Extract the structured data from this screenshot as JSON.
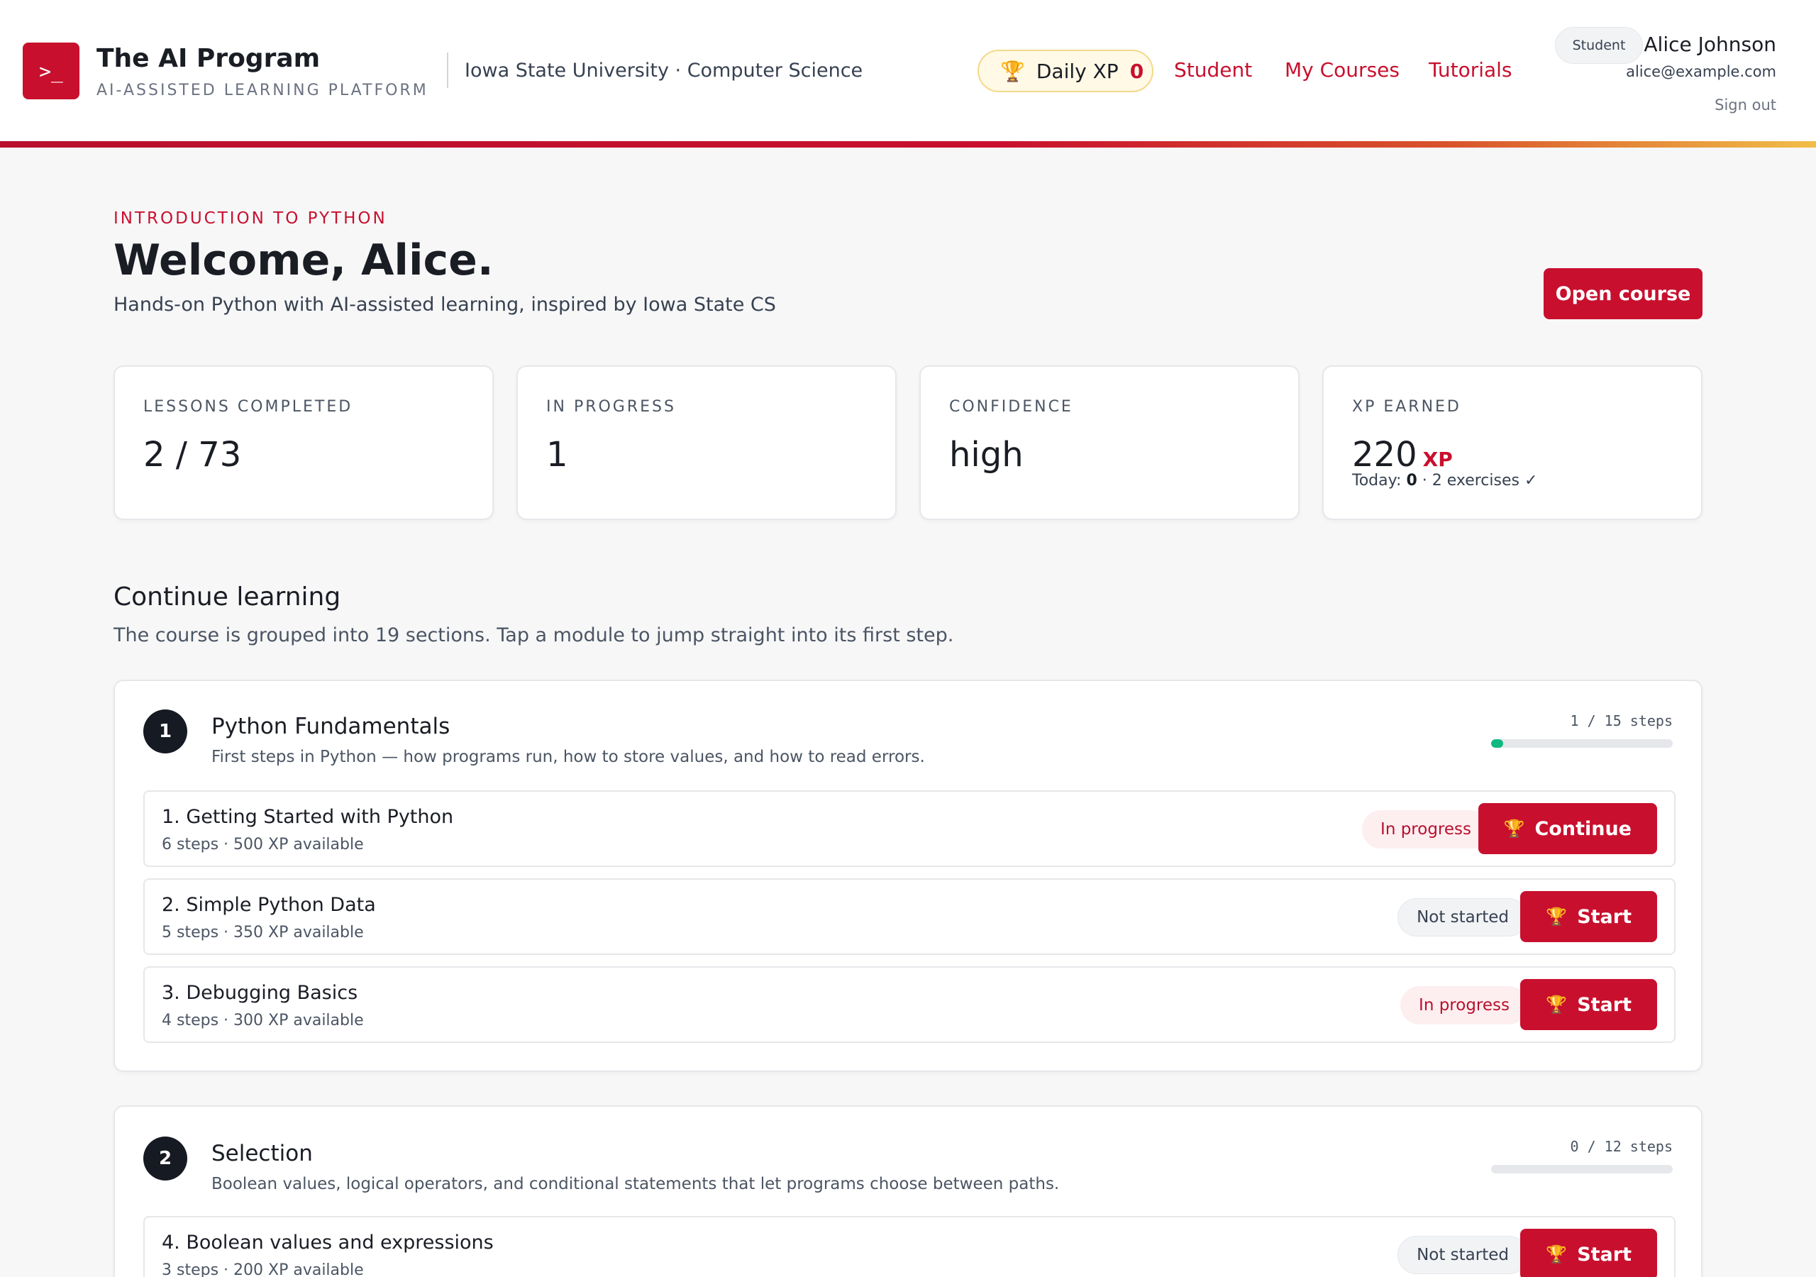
{
  "brand": {
    "logo_glyph": ">_",
    "title": "The AI Program",
    "subtitle": "AI-ASSISTED LEARNING PLATFORM",
    "institution": "Iowa State University · Computer Science",
    "accent_color": "#c8102e"
  },
  "header": {
    "daily_xp_label": "Daily XP",
    "daily_xp_value": "0",
    "trophy_icon": "trophy-icon",
    "nav": [
      "Student",
      "My Courses",
      "Tutorials"
    ],
    "role": "Student",
    "user_name": "Alice Johnson",
    "user_email": "alice@example.com",
    "sign_out": "Sign out"
  },
  "hero": {
    "eyebrow": "INTRODUCTION TO PYTHON",
    "welcome": "Welcome, Alice.",
    "tagline": "Hands-on Python with AI-assisted learning, inspired by Iowa State CS",
    "open_course": "Open course"
  },
  "stats": [
    {
      "label": "LESSONS COMPLETED",
      "value": "2 / 73"
    },
    {
      "label": "IN PROGRESS",
      "value": "1"
    },
    {
      "label": "CONFIDENCE",
      "value": "high"
    },
    {
      "label": "XP EARNED",
      "value": "220",
      "unit": "XP",
      "sub_prefix": "Today: ",
      "sub_bold": "0",
      "sub_suffix": " · 2 exercises ✓"
    }
  ],
  "continue": {
    "heading": "Continue learning",
    "description": "The course is grouped into 19 sections. Tap a module to jump straight into its first step."
  },
  "modules": [
    {
      "number": "1",
      "title": "Python Fundamentals",
      "description": "First steps in Python — how programs run, how to store values, and how to read errors.",
      "steps_label": "1 / 15 steps",
      "progress_fraction": 0.0667,
      "lessons": [
        {
          "title": "1. Getting Started with Python",
          "meta": "6 steps · 500 XP available",
          "status": "In progress",
          "action": "Continue"
        },
        {
          "title": "2. Simple Python Data",
          "meta": "5 steps · 350 XP available",
          "status": "Not started",
          "action": "Start"
        },
        {
          "title": "3. Debugging Basics",
          "meta": "4 steps · 300 XP available",
          "status": "In progress",
          "action": "Start"
        }
      ]
    },
    {
      "number": "2",
      "title": "Selection",
      "description": "Boolean values, logical operators, and conditional statements that let programs choose between paths.",
      "steps_label": "0 / 12 steps",
      "progress_fraction": 0,
      "lessons": [
        {
          "title": "4. Boolean values and expressions",
          "meta": "3 steps · 200 XP available",
          "status": "Not started",
          "action": "Start"
        }
      ]
    }
  ]
}
